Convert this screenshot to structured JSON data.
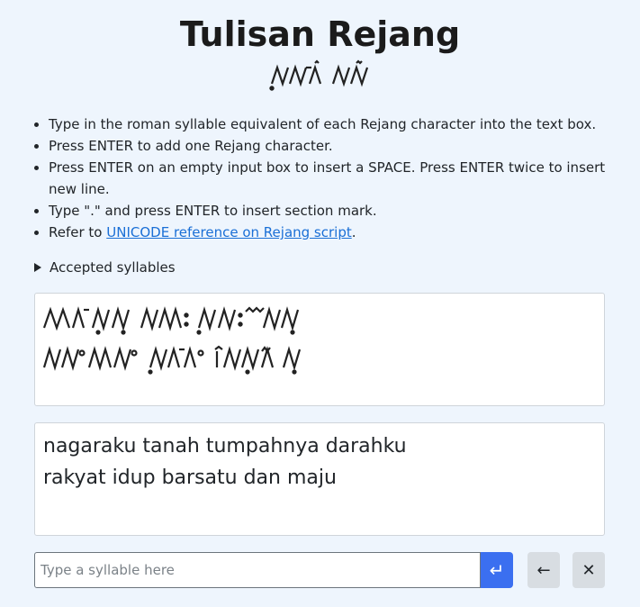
{
  "header": {
    "title": "Tulisan Rejang",
    "subtitle_script": "ꤼꤰꥉꤱ ꤽꥇꤾꥋ"
  },
  "instructions": [
    "Type in the roman syllable equivalent of each Rejang character into the text box.",
    "Press ENTER to add one Rejang character.",
    "Press ENTER on an empty input box to insert a SPACE. Press ENTER twice to insert new line.",
    "Type \".\" and press ENTER to insert section mark.",
    {
      "prefix": "Refer to ",
      "link": "UNICODE reference on Rejang script",
      "suffix": "."
    }
  ],
  "accepted_syllables_label": "Accepted syllables",
  "script_output": {
    "line1": "ꤺꤸꤽꤿꥋ ꤽꤰꥒ ꤼꤲꥍ ꤷꤽꥋ",
    "line2": "ꤽꤿꥇ ꤰꥊꤼ ꤰꤽꤿꤹ ꤷꤽꥍ ꤹꥋ"
  },
  "roman_output": {
    "line1": "nagaraku tanah tumpahnya darahku",
    "line2": "rakyat idup barsatu dan maju"
  },
  "input": {
    "placeholder": "Type a syllable here",
    "value": ""
  },
  "buttons": {
    "enter_icon": "return-arrow-icon",
    "enter_glyph": "↵",
    "back_icon": "arrow-left-icon",
    "back_glyph": "←",
    "clear_icon": "close-icon",
    "clear_glyph": "✕"
  }
}
